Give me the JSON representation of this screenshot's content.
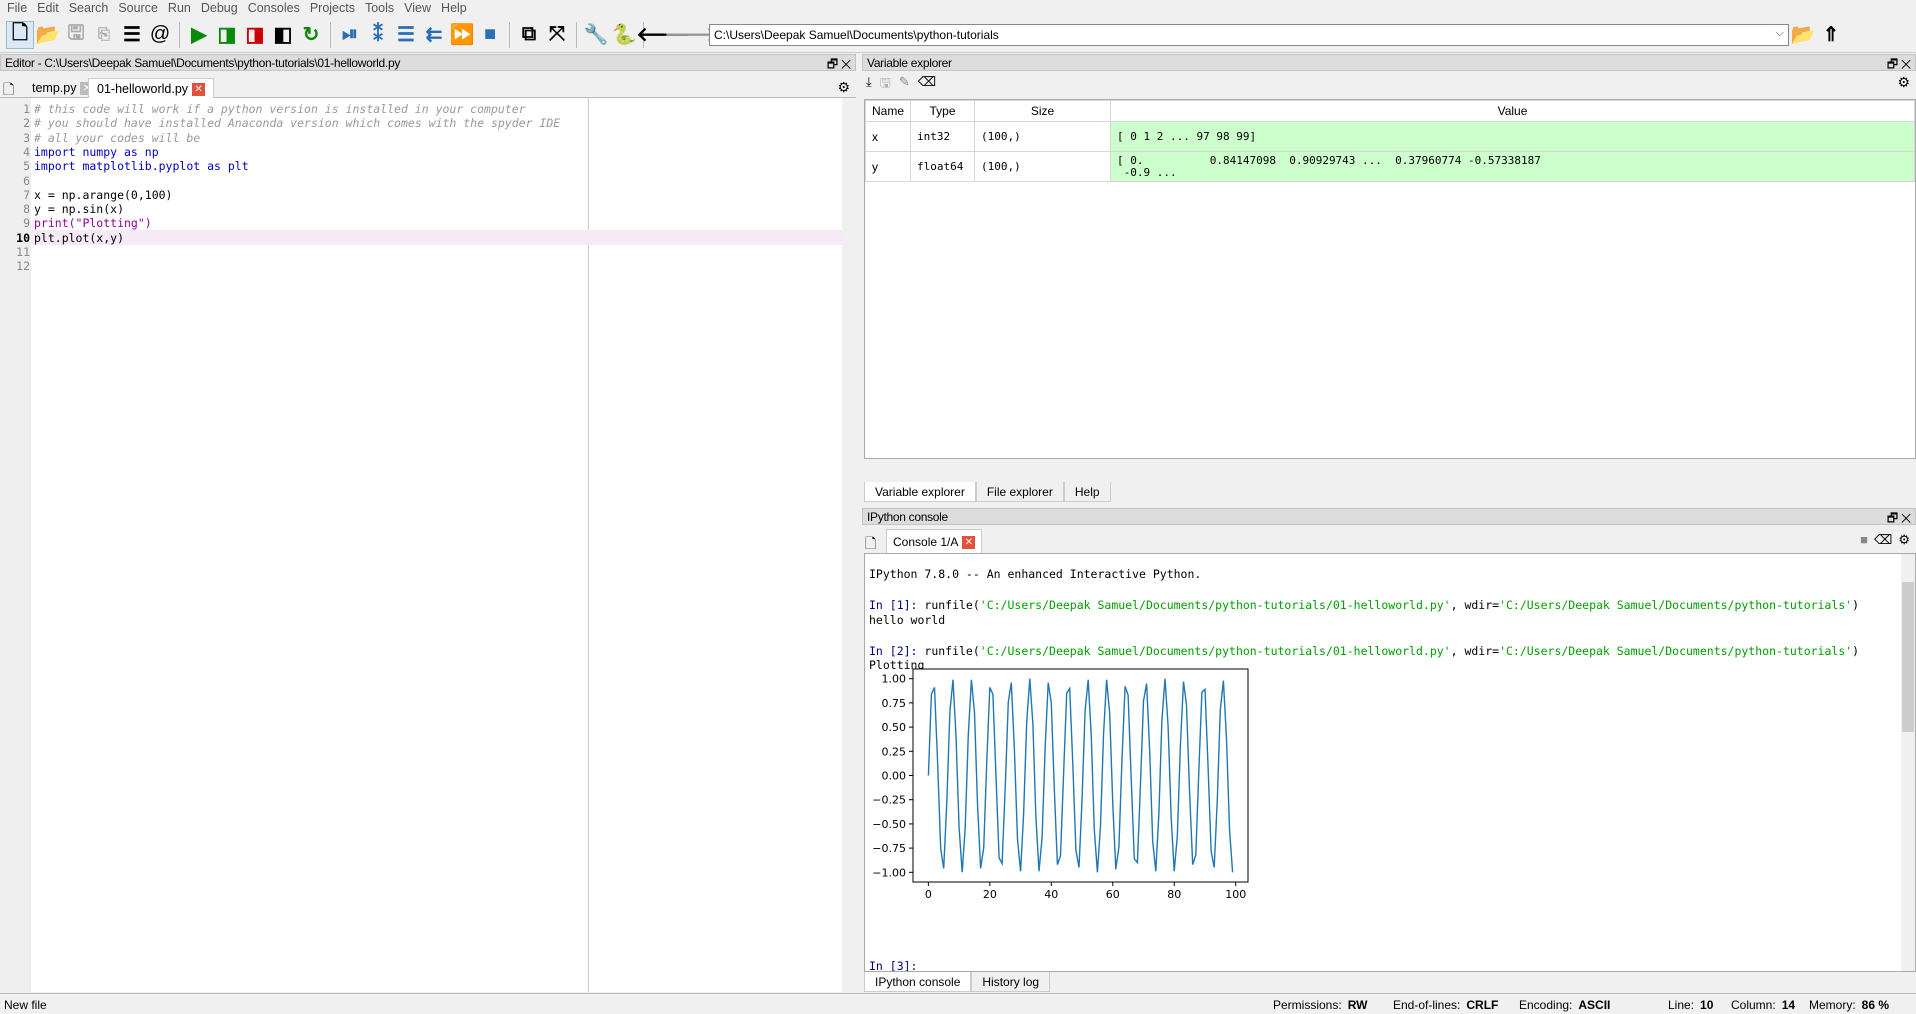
{
  "menu": [
    "File",
    "Edit",
    "Search",
    "Source",
    "Run",
    "Debug",
    "Consoles",
    "Projects",
    "Tools",
    "View",
    "Help"
  ],
  "toolbar": {
    "icons": [
      "new-file",
      "open-file",
      "save",
      "save-all",
      "outline",
      "at-sign",
      "run",
      "run-cell",
      "run-cell-advance",
      "run-selection",
      "rerun",
      "debug",
      "step",
      "step-into",
      "step-return",
      "continue",
      "stop",
      "maximize-pane",
      "fullscreen",
      "preferences",
      "python-path",
      "back",
      "forward"
    ],
    "path": "C:\\Users\\Deepak Samuel\\Documents\\python-tutorials"
  },
  "editor": {
    "title": "Editor - C:\\Users\\Deepak Samuel\\Documents\\python-tutorials\\01-helloworld.py",
    "tabs": [
      {
        "label": "temp.py",
        "active": false
      },
      {
        "label": "01-helloworld.py",
        "active": true
      }
    ],
    "current_line": 10,
    "lines": [
      "# this code will work if a python version is installed in your computer",
      "# you should have installed Anaconda version which comes with the spyder IDE",
      "# all your codes will be",
      "import numpy as np",
      "import matplotlib.pyplot as plt",
      "",
      "x = np.arange(0,100)",
      "y = np.sin(x)",
      "print(\"Plotting\")",
      "plt.plot(x,y)",
      "",
      ""
    ]
  },
  "variable_explorer": {
    "title": "Variable explorer",
    "columns": [
      "Name",
      "Type",
      "Size",
      "Value"
    ],
    "rows": [
      {
        "name": "x",
        "type": "int32",
        "size": "(100,)",
        "value": "[ 0  1  2 ... 97 98 99]"
      },
      {
        "name": "y",
        "type": "float64",
        "size": "(100,)",
        "value": "[ 0.          0.84147098  0.90929743 ...  0.37960774 -0.57338187\n -0.9 ..."
      }
    ],
    "tabs": [
      "Variable explorer",
      "File explorer",
      "Help"
    ],
    "highlight_color": "#ccffcc"
  },
  "console": {
    "title": "IPython console",
    "tab": "Console 1/A",
    "banner": "IPython 7.8.0 -- An enhanced Interactive Python.",
    "in1_prompt": "In [1]: ",
    "in1_code_a": "runfile(",
    "in1_str1": "'C:/Users/Deepak Samuel/Documents/python-tutorials/01-helloworld.py'",
    "in1_code_b": ", wdir=",
    "in1_str2": "'C:/Users/Deepak Samuel/Documents/python-tutorials'",
    "in1_code_c": ")",
    "out1": "hello world",
    "in2_prompt": "In [2]: ",
    "out2": "Plotting",
    "in3_prompt": "In [3]: ",
    "tabs": [
      "IPython console",
      "History log"
    ]
  },
  "chart_data": {
    "type": "line",
    "x_start": 0,
    "x_end": 99,
    "values": [
      0.0,
      0.84,
      0.91,
      0.14,
      -0.76,
      -0.96,
      -0.28,
      0.66,
      0.99,
      0.41,
      -0.54,
      -1.0,
      -0.54,
      0.42,
      0.99,
      0.65,
      -0.29,
      -0.96,
      -0.75,
      0.15,
      0.91,
      0.84,
      -0.01,
      -0.85,
      -0.91,
      -0.13,
      0.76,
      0.96,
      0.27,
      -0.66,
      -0.99,
      -0.4,
      0.55,
      1.0,
      0.53,
      -0.43,
      -0.99,
      -0.64,
      0.3,
      0.96,
      0.75,
      -0.16,
      -0.92,
      -0.83,
      0.02,
      0.85,
      0.9,
      0.12,
      -0.77,
      -0.95,
      -0.26,
      0.67,
      0.99,
      0.4,
      -0.56,
      -1.0,
      -0.52,
      0.44,
      0.99,
      0.64,
      -0.3,
      -0.97,
      -0.74,
      0.17,
      0.92,
      0.83,
      -0.03,
      -0.86,
      -0.9,
      -0.11,
      0.77,
      0.95,
      0.25,
      -0.68,
      -0.99,
      -0.39,
      0.57,
      1.0,
      0.51,
      -0.44,
      -0.99,
      -0.63,
      0.31,
      0.97,
      0.73,
      -0.18,
      -0.92,
      -0.82,
      0.04,
      0.86,
      0.89,
      0.11,
      -0.78,
      -0.95,
      -0.25,
      0.68,
      0.98,
      0.38,
      -0.57,
      -1.0
    ],
    "xlim": [
      -5,
      104
    ],
    "ylim": [
      -1.1,
      1.1
    ],
    "xticks": [
      "0",
      "20",
      "40",
      "60",
      "80",
      "100"
    ],
    "yticks": [
      "1.00",
      "0.75",
      "0.50",
      "0.25",
      "0.00",
      "−0.25",
      "−0.50",
      "−0.75",
      "−1.00"
    ],
    "line_color": "#1f77b4",
    "grid": false
  },
  "status": {
    "message": "New file",
    "permissions_label": "Permissions:",
    "permissions": "RW",
    "eol_label": "End-of-lines:",
    "eol": "CRLF",
    "encoding_label": "Encoding:",
    "encoding": "ASCII",
    "line_label": "Line:",
    "line": "10",
    "column_label": "Column:",
    "column": "14",
    "memory_label": "Memory:",
    "memory": "86 %"
  }
}
